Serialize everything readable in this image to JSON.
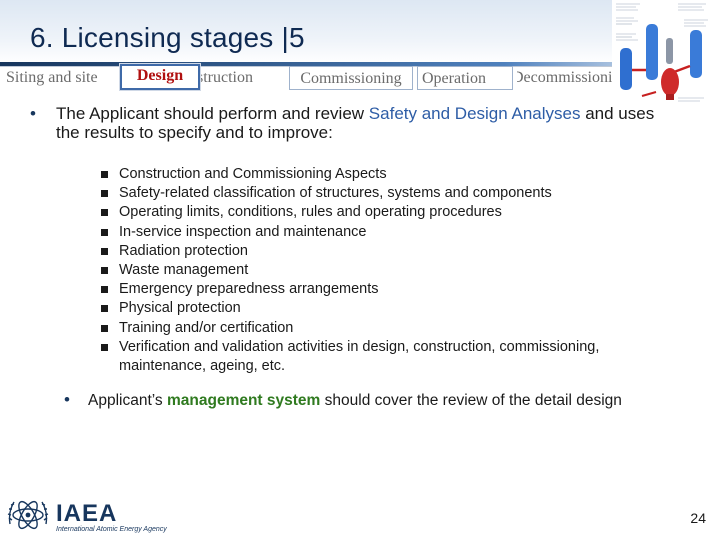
{
  "slide": {
    "title": "6. Licensing stages |5",
    "page_number": "24"
  },
  "stages": [
    {
      "label": "Siting and site",
      "active": false
    },
    {
      "label": "Design",
      "active": true
    },
    {
      "label": "nstruction",
      "active": false
    },
    {
      "label": "Commissioning",
      "active": false
    },
    {
      "label": "Operation",
      "active": false
    },
    {
      "label": "Decommissioning",
      "active": false
    }
  ],
  "main_bullet": {
    "prefix": "The Applicant should perform and review ",
    "highlight": "Safety and Design Analyses",
    "suffix": " and uses the results to specify and to improve:"
  },
  "sub_items": [
    "Construction and Commissioning Aspects",
    "Safety-related classification of structures, systems and components",
    "Operating limits, conditions, rules and operating procedures",
    "In-service inspection and maintenance",
    "Radiation protection",
    "Waste management",
    "Emergency preparedness arrangements",
    "Physical protection",
    "Training and/or certification",
    "Verification and validation activities in design, construction, commissioning, maintenance, ageing, etc."
  ],
  "second_bullet": {
    "prefix": "Applicant’s ",
    "highlight": "management system",
    "suffix": " should cover the review of the detail design"
  },
  "logo": {
    "name": "IAEA",
    "subtitle": "International Atomic Energy Agency"
  },
  "colors": {
    "title": "#0f2a52",
    "active_stage_text": "#b01010",
    "active_stage_border": "#3f6aa8",
    "highlight_blue": "#2e5da6",
    "highlight_green": "#2f7a1f"
  }
}
